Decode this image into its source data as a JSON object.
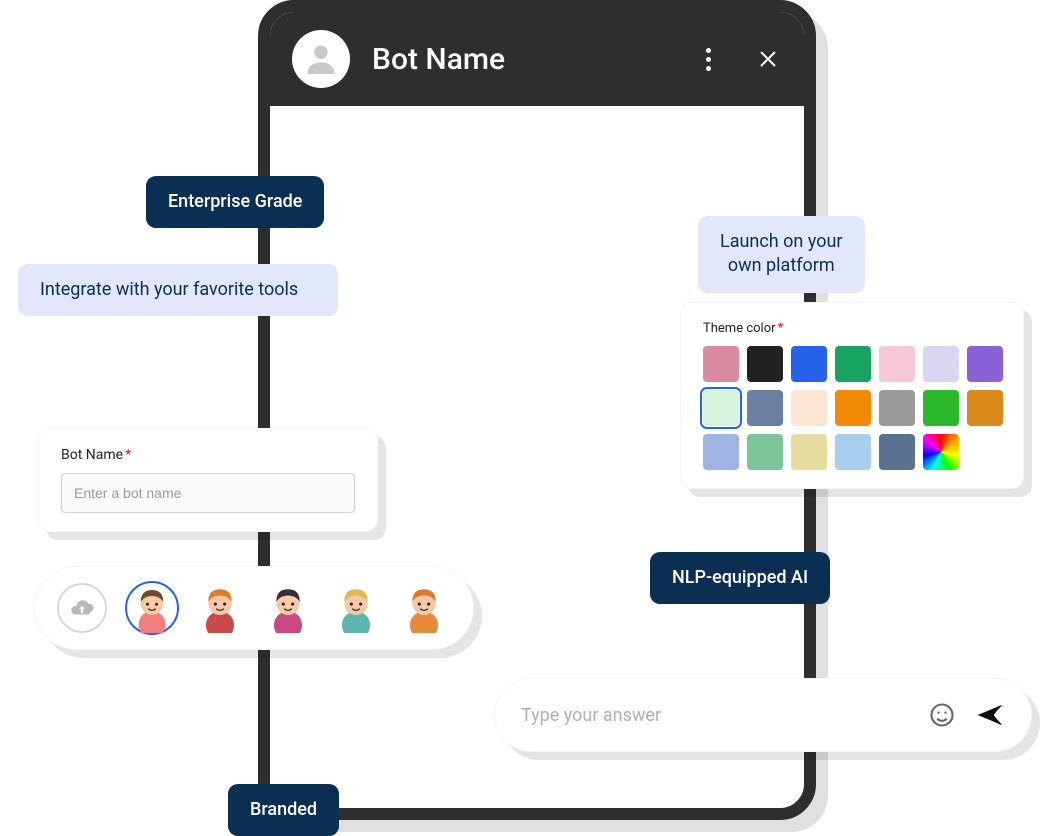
{
  "phone": {
    "title": "Bot Name"
  },
  "chips": {
    "enterprise": "Enterprise Grade",
    "integrate": "Integrate with your favorite tools",
    "launch": "Launch on your\nown platform",
    "nlp": "NLP-equipped AI",
    "branded": "Branded"
  },
  "botNameCard": {
    "label": "Bot Name",
    "required": "*",
    "placeholder": "Enter a bot name"
  },
  "themeCard": {
    "label": "Theme color",
    "required": "*",
    "colors": [
      "#d98aa0",
      "#222222",
      "#2563eb",
      "#18a460",
      "#f6c8d6",
      "#d8d6f0",
      "#8a60d6",
      "#SEL",
      "#6b7fa0",
      "#fde7d4",
      "#f28a00",
      "#9a9a9a",
      "#2bb82b",
      "#d98a1a",
      "#9fb4e4",
      "#7cc59a",
      "#e6dca0",
      "#a8cef0",
      "#5a7290",
      "#RAINBOW"
    ]
  },
  "avatarPicker": {
    "options": [
      {
        "name": "avatar-option-1",
        "hair": "#6b4a2e",
        "skin": "#f6c9a6",
        "shirt": "#f08080",
        "selected": true
      },
      {
        "name": "avatar-option-2",
        "hair": "#e07a2e",
        "skin": "#f6c9a6",
        "shirt": "#c94a4a",
        "selected": false
      },
      {
        "name": "avatar-option-3",
        "hair": "#3b2b3a",
        "skin": "#f6c9a6",
        "shirt": "#c94a80",
        "selected": false
      },
      {
        "name": "avatar-option-4",
        "hair": "#e2b84a",
        "skin": "#f6c9a6",
        "shirt": "#5fb5b0",
        "selected": false
      },
      {
        "name": "avatar-option-5",
        "hair": "#e07a2e",
        "skin": "#f6c9a6",
        "shirt": "#e68a3a",
        "selected": false
      }
    ]
  },
  "inputBar": {
    "placeholder": "Type your answer"
  }
}
